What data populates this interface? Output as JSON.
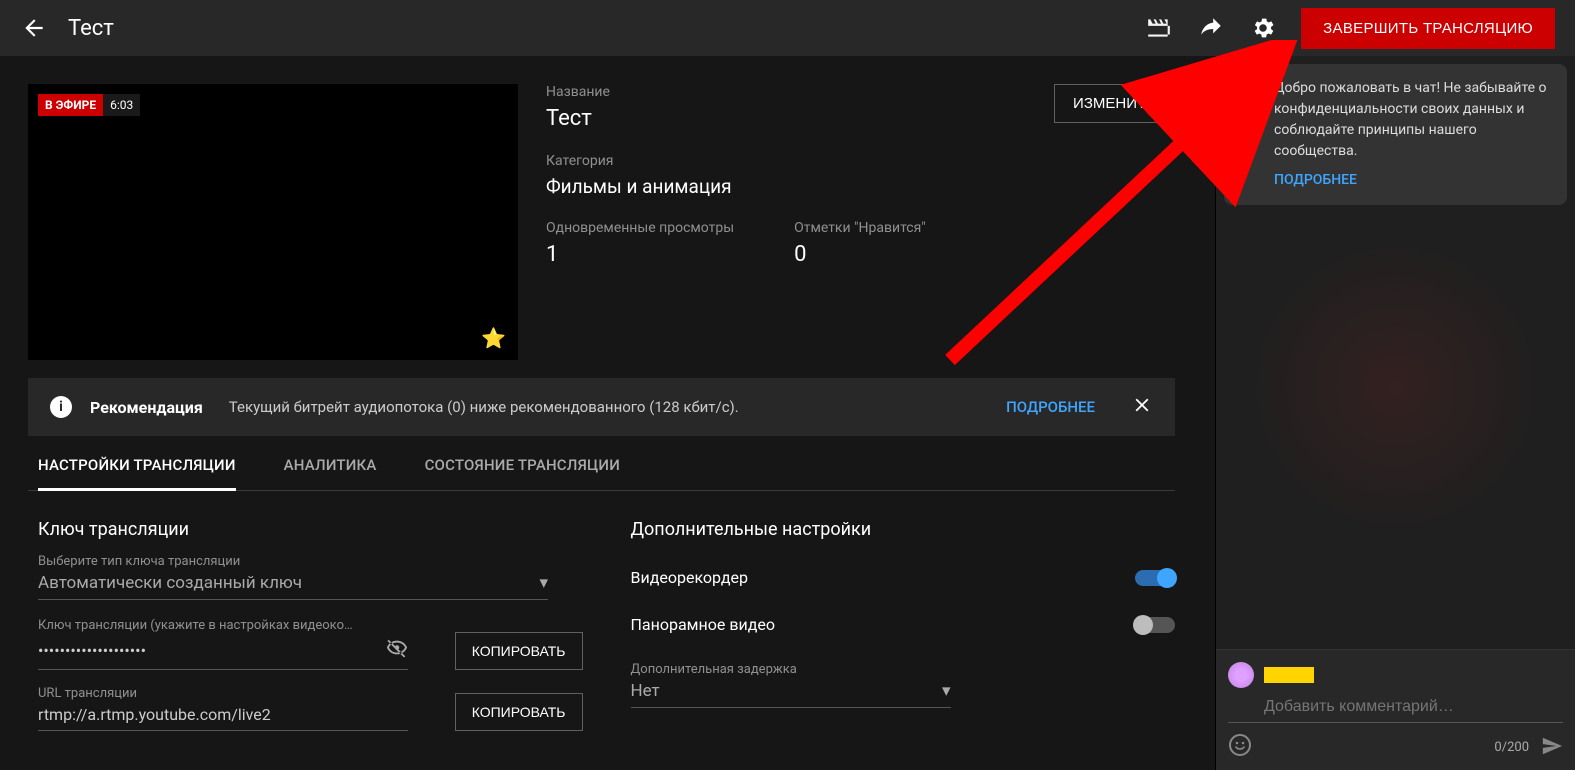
{
  "header": {
    "title": "Тест",
    "end_button": "ЗАВЕРШИТЬ ТРАНСЛЯЦИЮ"
  },
  "preview": {
    "live_badge": "В ЭФИРЕ",
    "time": "6:03"
  },
  "info": {
    "title_label": "Название",
    "title_value": "Тест",
    "category_label": "Категория",
    "category_value": "Фильмы и анимация",
    "viewers_label": "Одновременные просмотры",
    "viewers_value": "1",
    "likes_label": "Отметки \"Нравится\"",
    "likes_value": "0",
    "edit_button": "ИЗМЕНИТЬ"
  },
  "recommendation": {
    "title": "Рекомендация",
    "text": "Текущий битрейт аудиопотока (0) ниже рекомендованного (128 кбит/с).",
    "more": "ПОДРОБНЕЕ"
  },
  "tabs": {
    "items": [
      {
        "label": "НАСТРОЙКИ ТРАНСЛЯЦИИ",
        "active": true
      },
      {
        "label": "АНАЛИТИКА",
        "active": false
      },
      {
        "label": "СОСТОЯНИЕ ТРАНСЛЯЦИИ",
        "active": false
      }
    ]
  },
  "settings": {
    "left": {
      "section_title": "Ключ трансляции",
      "key_type_label": "Выберите тип ключа трансляции",
      "key_type_value": "Автоматически созданный ключ",
      "stream_key_label": "Ключ трансляции (укажите в настройках видеоко…",
      "stream_key_value": "••••••••••••••••••••",
      "url_label": "URL трансляции",
      "url_value": "rtmp://a.rtmp.youtube.com/live2",
      "copy_button": "КОПИРОВАТЬ"
    },
    "right": {
      "section_title": "Дополнительные настройки",
      "dvr_label": "Видеорекордер",
      "pano_label": "Панорамное видео",
      "latency_label": "Дополнительная задержка",
      "latency_value": "Нет"
    }
  },
  "chat": {
    "welcome_text": "Добро пожаловать в чат! Не забывайте о конфиденциальности своих данных и соблюдайте принципы нашего сообщества.",
    "welcome_more": "ПОДРОБНЕЕ",
    "input_placeholder": "Добавить комментарий…",
    "char_count": "0/200"
  }
}
